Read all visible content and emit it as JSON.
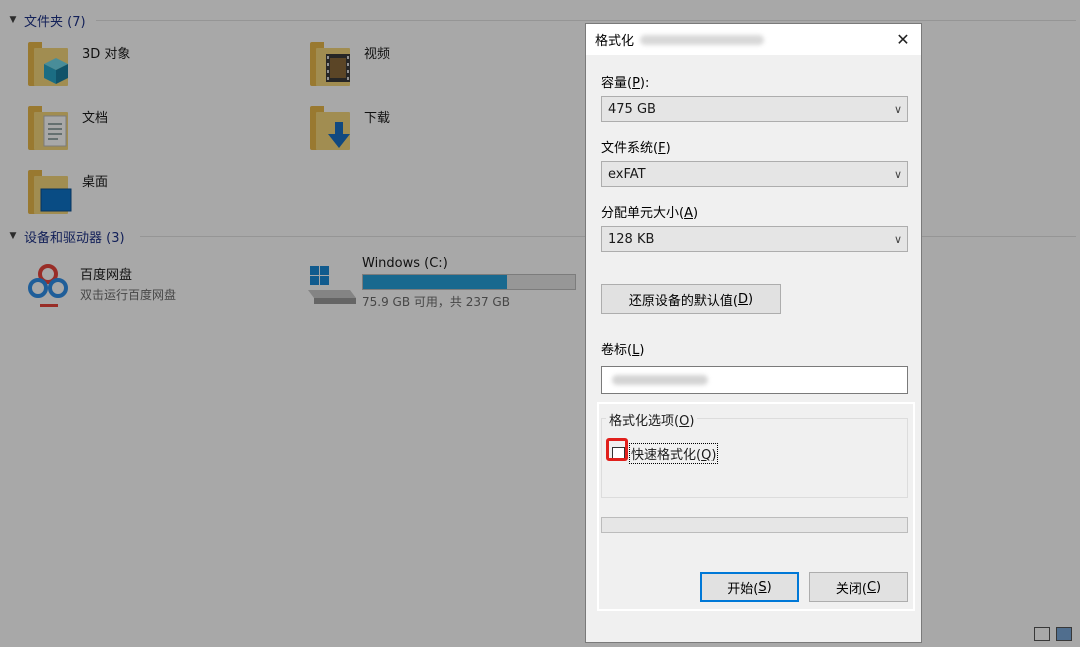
{
  "explorer": {
    "folders_header": "文件夹 (7)",
    "devices_header": "设备和驱动器 (3)",
    "folders": [
      {
        "label": "3D 对象",
        "icon": "3d-objects-folder-icon"
      },
      {
        "label": "视频",
        "icon": "videos-folder-icon"
      },
      {
        "label": "文档",
        "icon": "documents-folder-icon"
      },
      {
        "label": "下载",
        "icon": "downloads-folder-icon"
      },
      {
        "label": "桌面",
        "icon": "desktop-folder-icon"
      }
    ],
    "baidu": {
      "name": "百度网盘",
      "sub": "双击运行百度网盘",
      "icon": "baidu-netdisk-icon"
    },
    "drive_c": {
      "name": "Windows (C:)",
      "sub": "75.9 GB 可用，共 237 GB",
      "used_fraction": 0.68,
      "icon": "windows-drive-icon"
    }
  },
  "dialog": {
    "title": "格式化",
    "close": "✕",
    "capacity_label": "容量(",
    "capacity_key": "P",
    "capacity_tail": "):",
    "capacity_value": "475 GB",
    "fs_label": "文件系统(",
    "fs_key": "F",
    "fs_tail": ")",
    "fs_value": "exFAT",
    "alloc_label": "分配单元大小(",
    "alloc_key": "A",
    "alloc_tail": ")",
    "alloc_value": "128 KB",
    "restore_label": "还原设备的默认值(",
    "restore_key": "D",
    "restore_tail": ")",
    "volume_label": "卷标(",
    "volume_key": "L",
    "volume_tail": ")",
    "options_label": "格式化选项(",
    "options_key": "O",
    "options_tail": ")",
    "quick_label": "快速格式化(",
    "quick_key": "Q",
    "quick_tail": ")",
    "start_label": "开始(",
    "start_key": "S",
    "start_tail": ")",
    "closebtn_label": "关闭(",
    "closebtn_key": "C",
    "closebtn_tail": ")"
  },
  "colors": {
    "accent": "#26a0da",
    "highlight": "#e0201c",
    "header_text": "#1e3287"
  }
}
